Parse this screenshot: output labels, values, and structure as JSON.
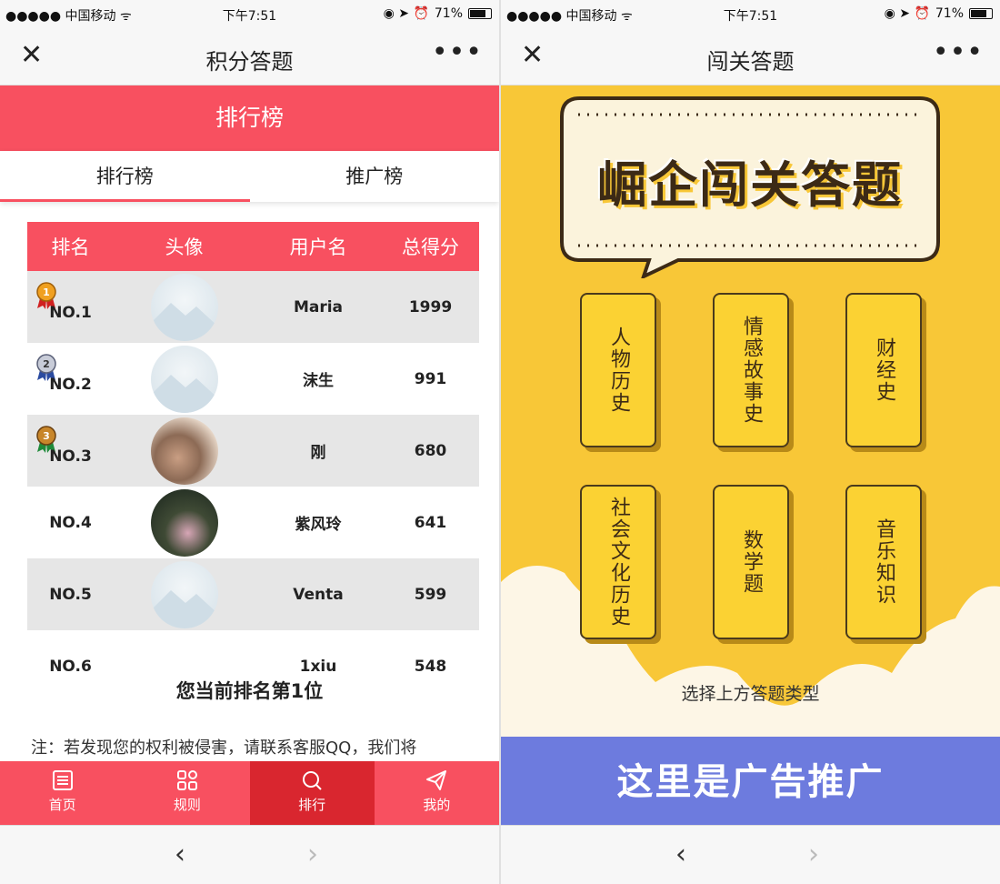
{
  "left": {
    "status": {
      "carrier": "●●●●● 中国移动 ᯤ",
      "time": "下午7:51",
      "battery": "71%"
    },
    "nav": {
      "close": "✕",
      "title": "积分答题",
      "more": "•••"
    },
    "banner": "排行榜",
    "tabs": [
      "排行榜",
      "推广榜"
    ],
    "table": {
      "headers": [
        "排名",
        "头像",
        "用户名",
        "总得分"
      ],
      "rows": [
        {
          "rank": "NO.1",
          "name": "Maria",
          "score": "1999"
        },
        {
          "rank": "NO.2",
          "name": "沫生",
          "score": "991"
        },
        {
          "rank": "NO.3",
          "name": "刚",
          "score": "680"
        },
        {
          "rank": "NO.4",
          "name": "紫风玲",
          "score": "641"
        },
        {
          "rank": "NO.5",
          "name": "Venta",
          "score": "599"
        },
        {
          "rank": "NO.6",
          "name": "1xiu",
          "score": "548"
        }
      ]
    },
    "my_rank": "您当前排名第1位",
    "note": "注：若发现您的权利被侵害，请联系客服QQ，我们将",
    "tabbar": [
      "首页",
      "规则",
      "排行",
      "我的"
    ],
    "bottom": {
      "back": "‹",
      "forward": "›"
    },
    "colors": {
      "accent": "#f85060",
      "active_tab": "#d9262f"
    }
  },
  "right": {
    "status": {
      "carrier": "●●●●● 中国移动 ᯤ",
      "time": "下午7:51",
      "battery": "71%"
    },
    "nav": {
      "close": "✕",
      "title": "闯关答题",
      "more": "•••"
    },
    "big_title": "崛企闯关答题",
    "categories": [
      "人物历史",
      "情感故事史",
      "财经史",
      "社会文化历史",
      "数学题",
      "音乐知识"
    ],
    "choose": "选择上方答题类型",
    "ad": "这里是广告推广",
    "bottom": {
      "back": "‹",
      "forward": "›"
    },
    "colors": {
      "background": "#f8c737",
      "ad": "#6d7bde"
    }
  }
}
